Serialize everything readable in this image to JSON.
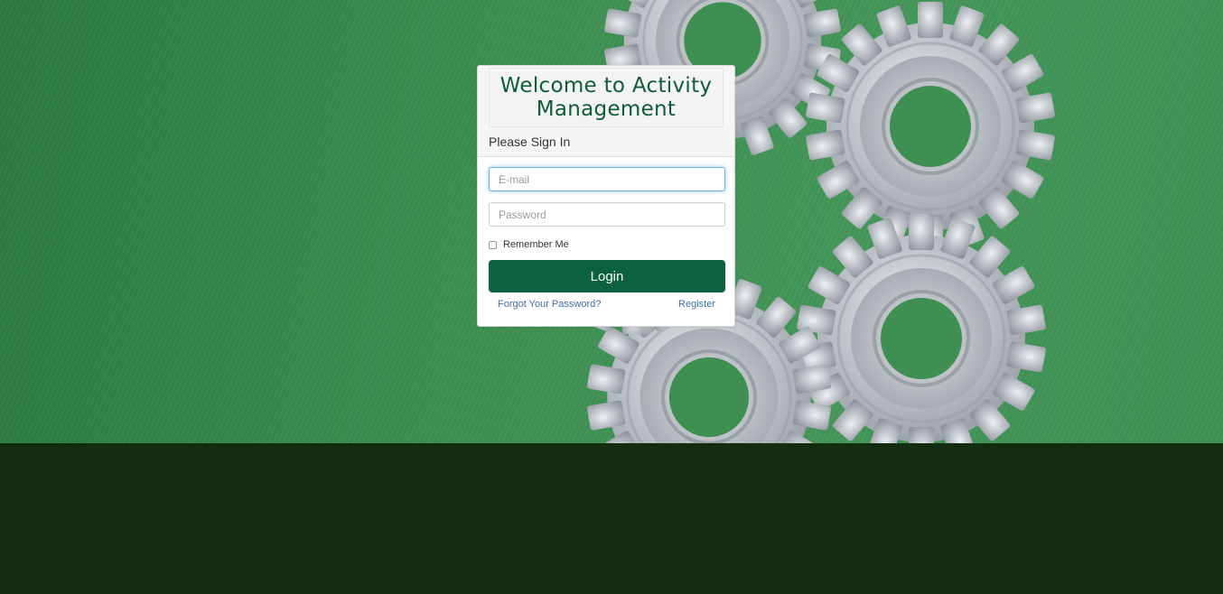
{
  "login": {
    "title": "Welcome to Activity Management",
    "subtitle": "Please Sign In",
    "email_placeholder": "E-mail",
    "password_placeholder": "Password",
    "remember_label": "Remember Me",
    "login_label": "Login",
    "forgot_label": "Forgot Your Password?",
    "register_label": "Register"
  },
  "colors": {
    "accent": "#0b6140",
    "background_green": "#3d8f52",
    "footer": "#132d10",
    "link": "#3e6ea6"
  },
  "icons": [
    "gear-icon"
  ]
}
